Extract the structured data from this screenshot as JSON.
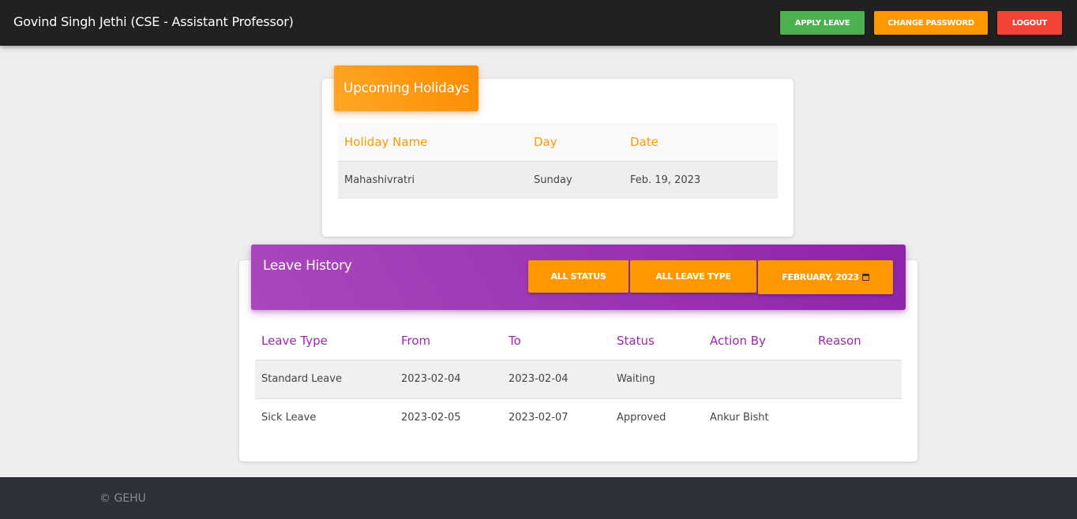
{
  "navbar": {
    "title": "Govind Singh Jethi (CSE - Assistant Professor)",
    "apply_label": "APPLY LEAVE",
    "change_password_label": "CHANGE PASSWORD",
    "logout_label": "LOGOUT"
  },
  "holidays": {
    "title": "Upcoming Holidays",
    "columns": [
      "Holiday Name",
      "Day",
      "Date"
    ],
    "rows": [
      [
        "Mahashivratri",
        "Sunday",
        "Feb. 19, 2023"
      ]
    ]
  },
  "leave_history": {
    "title": "Leave History",
    "filters": {
      "status": "ALL STATUS",
      "leave_type": "ALL LEAVE TYPE",
      "month": "FEBRUARY, 2023"
    },
    "columns": [
      "Leave Type",
      "From",
      "To",
      "Status",
      "Action By",
      "Reason"
    ],
    "rows": [
      [
        "Standard Leave",
        "2023-02-04",
        "2023-02-04",
        "Waiting",
        "",
        ""
      ],
      [
        "Sick Leave",
        "2023-02-05",
        "2023-02-07",
        "Approved",
        "Ankur Bisht",
        ""
      ]
    ]
  },
  "footer": {
    "text": "© GEHU"
  },
  "colors": {
    "navbar": "#212121",
    "apply": "#4caf50",
    "warning": "#ff9800",
    "danger": "#f44336",
    "purple": "#9c27b0"
  }
}
